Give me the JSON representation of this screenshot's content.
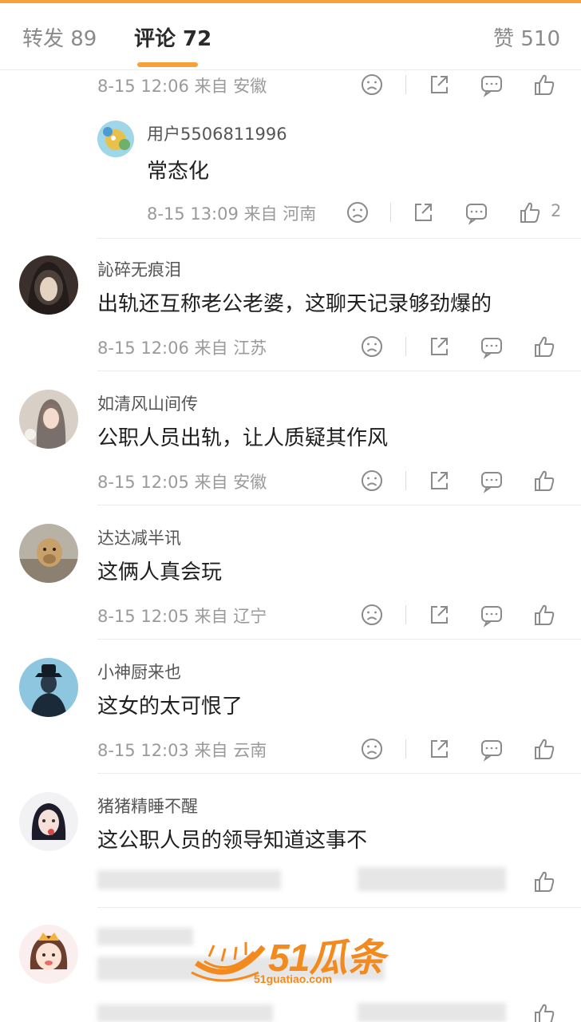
{
  "tabs": {
    "repost": "转发 89",
    "comments": "评论 72",
    "likes": "赞 510"
  },
  "top_row": {
    "time": "8-15 12:06 来自 安徽"
  },
  "reply": {
    "username": "用户5506811996",
    "text": "常态化",
    "time": "8-15 13:09 来自 河南",
    "like_count": "2"
  },
  "comments": [
    {
      "username": "訫碎无痕泪",
      "text": "出轨还互称老公老婆，这聊天记录够劲爆的",
      "time": "8-15 12:06 来自 江苏"
    },
    {
      "username": "如清风山间传",
      "text": "公职人员出轨，让人质疑其作风",
      "time": "8-15 12:05 来自 安徽"
    },
    {
      "username": "达达减半讯",
      "text": "这俩人真会玩",
      "time": "8-15 12:05 来自 辽宁"
    },
    {
      "username": "小神厨来也",
      "text": "这女的太可恨了",
      "time": "8-15 12:03 来自 云南"
    },
    {
      "username": "猪猪精睡不醒",
      "text": "这公职人员的领导知道这事不",
      "time": ""
    }
  ],
  "watermark": {
    "brand": "51瓜条",
    "site": "51guatiao.com"
  },
  "colors": {
    "accent": "#f7a13a",
    "watermark": "#f28a1e",
    "icon": "#8a8a8a"
  },
  "icons": [
    "sad-face-icon",
    "share-icon",
    "comment-icon",
    "thumbs-up-icon"
  ]
}
